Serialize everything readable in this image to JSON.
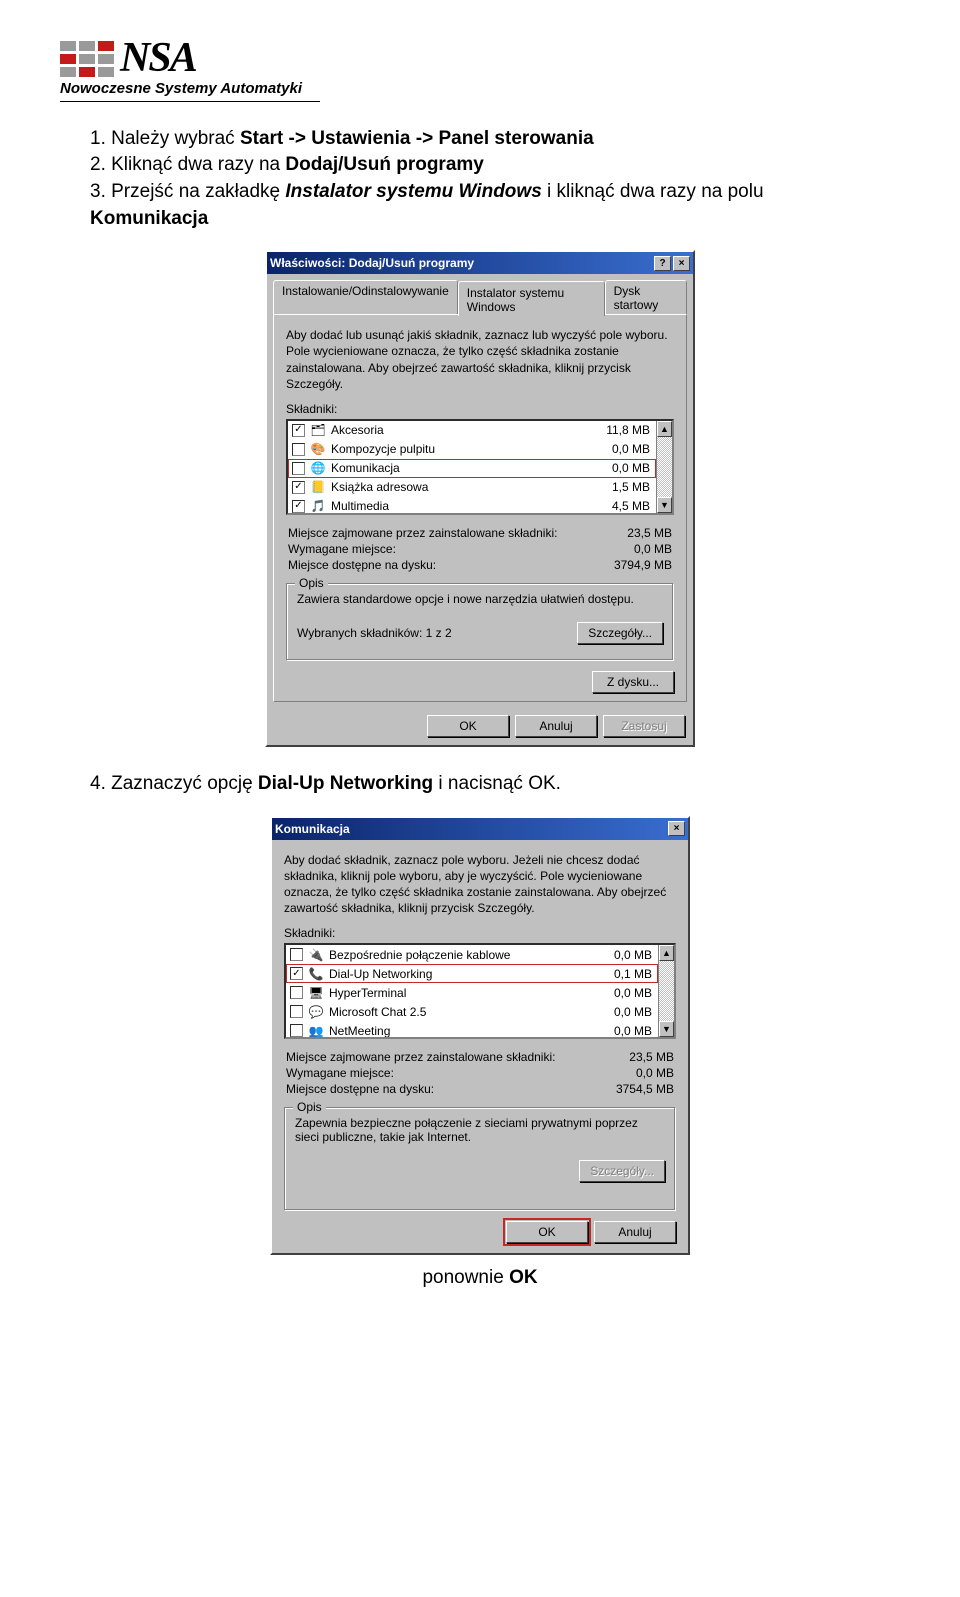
{
  "logo": {
    "text": "NSA",
    "subtitle": "Nowoczesne Systemy Automatyki"
  },
  "instructions": {
    "step1_a": "1.  Należy wybrać ",
    "step1_b": "Start -> Ustawienia -> Panel sterowania",
    "step2_a": "2.  Kliknąć dwa razy na ",
    "step2_b": "Dodaj/Usuń programy",
    "step3_a": "3.  Przejść na zakładkę ",
    "step3_b": "Instalator systemu Windows",
    "step3_c": " i kliknąć dwa razy na polu ",
    "step3_d": "Komunikacja",
    "step4_a": "4.  Zaznaczyć opcję ",
    "step4_b": "Dial-Up Networking",
    "step4_c": " i nacisnąć OK.",
    "footer_a": "ponownie ",
    "footer_b": "OK"
  },
  "dialog1": {
    "title": "Właściwości: Dodaj/Usuń programy",
    "help": "?",
    "close": "×",
    "tabs": [
      "Instalowanie/Odinstalowywanie",
      "Instalator systemu Windows",
      "Dysk startowy"
    ],
    "desc": "Aby dodać lub usunąć jakiś składnik, zaznacz lub wyczyść pole wyboru. Pole wycieniowane oznacza, że tylko część składnika zostanie zainstalowana. Aby obejrzeć zawartość składnika, kliknij przycisk Szczegóły.",
    "components_label": "Składniki:",
    "items": [
      {
        "checked": true,
        "icon": "🗂",
        "label": "Akcesoria",
        "size": "11,8 MB"
      },
      {
        "checked": false,
        "icon": "🎨",
        "label": "Kompozycje pulpitu",
        "size": "0,0 MB"
      },
      {
        "checked": false,
        "icon": "🌐",
        "label": "Komunikacja",
        "size": "0,0 MB",
        "highlight": true
      },
      {
        "checked": true,
        "icon": "📒",
        "label": "Książka adresowa",
        "size": "1,5 MB"
      },
      {
        "checked": true,
        "icon": "🎵",
        "label": "Multimedia",
        "size": "4,5 MB"
      }
    ],
    "info": {
      "used_label": "Miejsce zajmowane przez zainstalowane składniki:",
      "used_val": "23,5 MB",
      "req_label": "Wymagane miejsce:",
      "req_val": "0,0 MB",
      "free_label": "Miejsce dostępne na dysku:",
      "free_val": "3794,9 MB"
    },
    "opis_legend": "Opis",
    "opis_text": "Zawiera standardowe opcje i nowe narzędzia ułatwień dostępu.",
    "selcount": "Wybranych składników: 1 z 2",
    "details_btn": "Szczegóły...",
    "disk_btn": "Z dysku...",
    "ok": "OK",
    "cancel": "Anuluj",
    "apply": "Zastosuj"
  },
  "dialog2": {
    "title": "Komunikacja",
    "close": "×",
    "desc": "Aby dodać składnik, zaznacz pole wyboru. Jeżeli nie chcesz dodać składnika, kliknij pole wyboru, aby je wyczyścić. Pole wycieniowane oznacza, że tylko część składnika zostanie zainstalowana. Aby obejrzeć zawartość składnika, kliknij przycisk Szczegóły.",
    "components_label": "Składniki:",
    "items": [
      {
        "checked": false,
        "icon": "🔌",
        "label": "Bezpośrednie połączenie kablowe",
        "size": "0,0 MB"
      },
      {
        "checked": true,
        "icon": "📞",
        "label": "Dial-Up Networking",
        "size": "0,1 MB",
        "highlight": true
      },
      {
        "checked": false,
        "icon": "🖥",
        "label": "HyperTerminal",
        "size": "0,0 MB"
      },
      {
        "checked": false,
        "icon": "💬",
        "label": "Microsoft Chat 2.5",
        "size": "0,0 MB"
      },
      {
        "checked": false,
        "icon": "👥",
        "label": "NetMeeting",
        "size": "0,0 MB"
      }
    ],
    "info": {
      "used_label": "Miejsce zajmowane przez zainstalowane składniki:",
      "used_val": "23,5 MB",
      "req_label": "Wymagane miejsce:",
      "req_val": "0,0 MB",
      "free_label": "Miejsce dostępne na dysku:",
      "free_val": "3754,5 MB"
    },
    "opis_legend": "Opis",
    "opis_text": "Zapewnia bezpieczne połączenie z sieciami prywatnymi poprzez sieci publiczne, takie jak Internet.",
    "details_btn": "Szczegóły...",
    "ok": "OK",
    "cancel": "Anuluj"
  }
}
